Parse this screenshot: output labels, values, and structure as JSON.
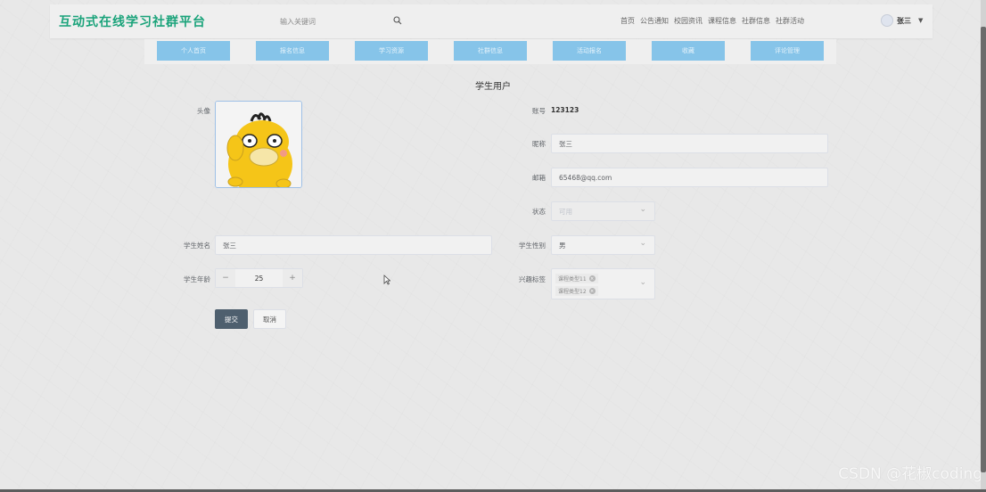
{
  "header": {
    "brand": "互动式在线学习社群平台",
    "search_placeholder": "输入关键词",
    "nav": [
      "首页",
      "公告通知",
      "校园资讯",
      "课程信息",
      "社群信息",
      "社群活动"
    ],
    "user_name": "张三"
  },
  "tabs": [
    "个人首页",
    "报名信息",
    "学习资源",
    "社群信息",
    "活动报名",
    "收藏",
    "评论管理"
  ],
  "page_title": "学生用户",
  "form": {
    "avatar_label": "头像",
    "account_label": "账号",
    "account_value": "123123",
    "nickname_label": "昵称",
    "nickname_value": "张三",
    "email_label": "邮箱",
    "email_value": "65468@qq.com",
    "status_label": "状态",
    "status_value": "可用",
    "student_name_label": "学生姓名",
    "student_name_value": "张三",
    "gender_label": "学生性别",
    "gender_value": "男",
    "age_label": "学生年龄",
    "age_value": "25",
    "age_minus": "−",
    "age_plus": "+",
    "interest_label": "兴趣标签",
    "interest_tags": [
      "课程类型11",
      "课程类型12"
    ],
    "submit_label": "提交",
    "cancel_label": "取消"
  },
  "watermark": "CSDN @花椒coding",
  "colors": {
    "brand": "#1aa37a",
    "tab_bg": "#86c4e9",
    "submit_bg": "#4e5f6e",
    "avatar_border": "#9ec0e6"
  }
}
